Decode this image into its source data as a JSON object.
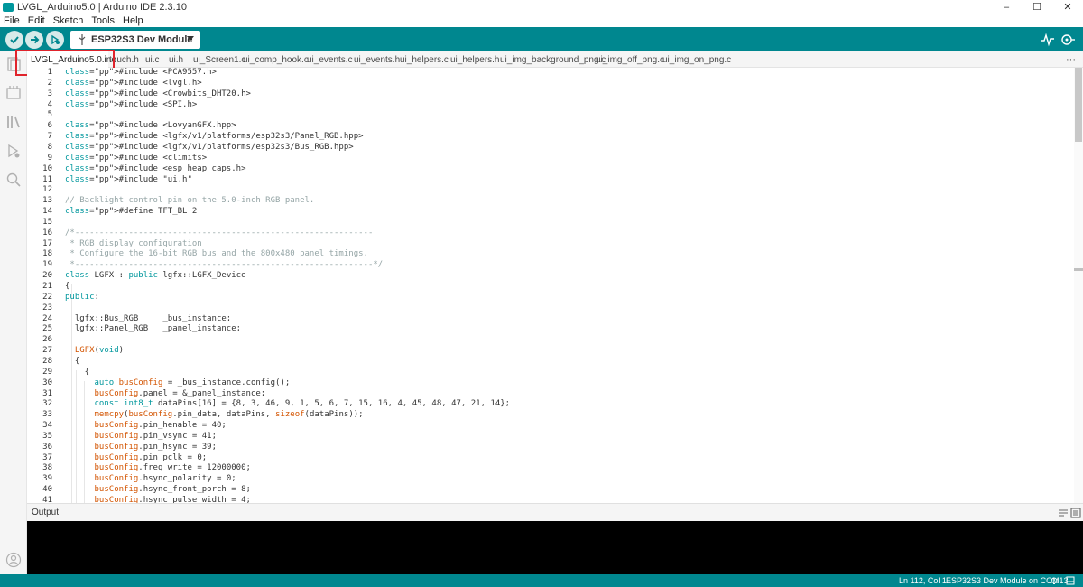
{
  "window": {
    "title": "LVGL_Arduino5.0 | Arduino IDE 2.3.10",
    "controls": [
      "–",
      "☐",
      "✕"
    ]
  },
  "menu": [
    "File",
    "Edit",
    "Sketch",
    "Tools",
    "Help"
  ],
  "toolbar": {
    "board": "ESP32S3 Dev Module",
    "verify_icon": "check-icon",
    "upload_icon": "arrow-right-icon",
    "debug_icon": "debugger-icon",
    "serial_plotter_icon": "plotter-icon",
    "serial_monitor_icon": "monitor-icon",
    "accent_color": "#00878f"
  },
  "tabs": [
    "LVGL_Arduino5.0.ino",
    "touch.h",
    "ui.c",
    "ui.h",
    "ui_Screen1.c",
    "ui_comp_hook.c",
    "ui_events.c",
    "ui_events.h",
    "ui_helpers.c",
    "ui_helpers.h",
    "ui_img_background_png.c",
    "ui_img_off_png.c",
    "ui_img_on_png.c"
  ],
  "tabs_more": "···",
  "code": [
    {
      "n": "1",
      "t": "#include <PCA9557.h>"
    },
    {
      "n": "2",
      "t": "#include <lvgl.h>"
    },
    {
      "n": "3",
      "t": "#include <Crowbits_DHT20.h>"
    },
    {
      "n": "4",
      "t": "#include <SPI.h>"
    },
    {
      "n": "5",
      "t": ""
    },
    {
      "n": "6",
      "t": "#include <LovyanGFX.hpp>"
    },
    {
      "n": "7",
      "t": "#include <lgfx/v1/platforms/esp32s3/Panel_RGB.hpp>"
    },
    {
      "n": "8",
      "t": "#include <lgfx/v1/platforms/esp32s3/Bus_RGB.hpp>"
    },
    {
      "n": "9",
      "t": "#include <climits>"
    },
    {
      "n": "10",
      "t": "#include <esp_heap_caps.h>"
    },
    {
      "n": "11",
      "t": "#include \"ui.h\""
    },
    {
      "n": "12",
      "t": ""
    },
    {
      "n": "13",
      "t": "// Backlight control pin on the 5.0-inch RGB panel."
    },
    {
      "n": "14",
      "t": "#define TFT_BL 2"
    },
    {
      "n": "15",
      "t": ""
    },
    {
      "n": "16",
      "t": "/*-------------------------------------------------------------"
    },
    {
      "n": "17",
      "t": " * RGB display configuration"
    },
    {
      "n": "18",
      "t": " * Configure the 16-bit RGB bus and the 800x480 panel timings."
    },
    {
      "n": "19",
      "t": " *-------------------------------------------------------------*/"
    },
    {
      "n": "20",
      "t": "class LGFX : public lgfx::LGFX_Device"
    },
    {
      "n": "21",
      "t": "{"
    },
    {
      "n": "22",
      "t": "public:"
    },
    {
      "n": "23",
      "t": ""
    },
    {
      "n": "24",
      "t": "  lgfx::Bus_RGB     _bus_instance;"
    },
    {
      "n": "25",
      "t": "  lgfx::Panel_RGB   _panel_instance;"
    },
    {
      "n": "26",
      "t": ""
    },
    {
      "n": "27",
      "t": "  LGFX(void)"
    },
    {
      "n": "28",
      "t": "  {"
    },
    {
      "n": "29",
      "t": "    {"
    },
    {
      "n": "30",
      "t": "      auto busConfig = _bus_instance.config();"
    },
    {
      "n": "31",
      "t": "      busConfig.panel = &_panel_instance;"
    },
    {
      "n": "32",
      "t": "      const int8_t dataPins[16] = {8, 3, 46, 9, 1, 5, 6, 7, 15, 16, 4, 45, 48, 47, 21, 14};"
    },
    {
      "n": "33",
      "t": "      memcpy(busConfig.pin_data, dataPins, sizeof(dataPins));"
    },
    {
      "n": "34",
      "t": "      busConfig.pin_henable = 40;"
    },
    {
      "n": "35",
      "t": "      busConfig.pin_vsync = 41;"
    },
    {
      "n": "36",
      "t": "      busConfig.pin_hsync = 39;"
    },
    {
      "n": "37",
      "t": "      busConfig.pin_pclk = 0;"
    },
    {
      "n": "38",
      "t": "      busConfig.freq_write = 12000000;"
    },
    {
      "n": "39",
      "t": "      busConfig.hsync_polarity = 0;"
    },
    {
      "n": "40",
      "t": "      busConfig.hsync_front_porch = 8;"
    },
    {
      "n": "41",
      "t": "      busConfig.hsync_pulse_width = 4;"
    }
  ],
  "output": {
    "title": "Output"
  },
  "statusbar": {
    "position": "Ln 112, Col 1",
    "board_port": "ESP32S3 Dev Module on COM13"
  }
}
